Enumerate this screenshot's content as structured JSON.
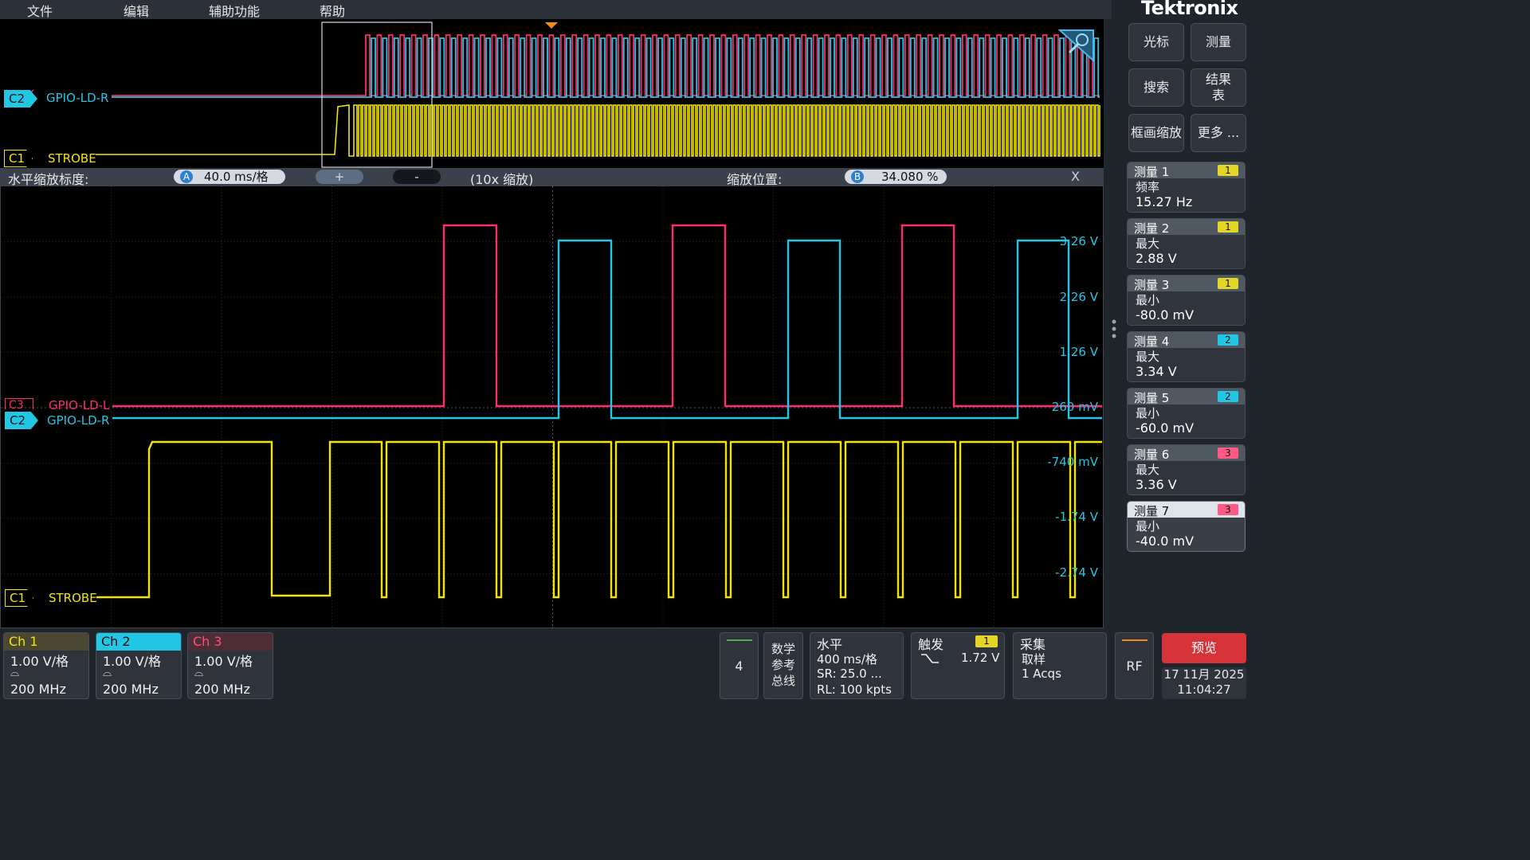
{
  "menu": {
    "file": "文件",
    "edit": "编辑",
    "utility": "辅助功能",
    "help": "帮助"
  },
  "brand": "Tektronix",
  "side_buttons": {
    "cursor": "光标",
    "measure": "测量",
    "search": "搜索",
    "results_line1": "结果",
    "results_line2": "表",
    "zoom": "框画缩放",
    "more": "更多 ..."
  },
  "measurements": [
    {
      "title": "测量 1",
      "badge": "1",
      "param": "频率",
      "value": "15.27 Hz"
    },
    {
      "title": "测量 2",
      "badge": "1",
      "param": "最大",
      "value": "2.88 V"
    },
    {
      "title": "测量 3",
      "badge": "1",
      "param": "最小",
      "value": "-80.0 mV"
    },
    {
      "title": "测量 4",
      "badge": "2",
      "param": "最大",
      "value": "3.34 V"
    },
    {
      "title": "测量 5",
      "badge": "2",
      "param": "最小",
      "value": "-60.0 mV"
    },
    {
      "title": "测量 6",
      "badge": "3",
      "param": "最大",
      "value": "3.36 V"
    },
    {
      "title": "测量 7",
      "badge": "3",
      "param": "最小",
      "value": "-40.0 mV"
    }
  ],
  "zoom_bar": {
    "label": "水平缩放标度:",
    "a_badge": "A",
    "scale": "40.0 ms/格",
    "plus": "+",
    "minus": "-",
    "factor": "(10x 缩放)",
    "pos_label": "缩放位置:",
    "b_badge": "B",
    "position": "34.080 %",
    "close": "X"
  },
  "channels": {
    "c1": {
      "badge": "C1",
      "label": "STROBE"
    },
    "c2": {
      "badge": "C2",
      "label": "GPIO-LD-R"
    },
    "c3": {
      "badge": "C3",
      "label": "GPIO-LD-L"
    }
  },
  "overview_c3_label": "GPIO-LD-R",
  "axis_labels": [
    "3.26 V",
    "2.26 V",
    "1.26 V",
    "260 mV",
    "-740 mV",
    "-1.74 V",
    "-2.74 V"
  ],
  "bottom": {
    "ch1": {
      "title": "Ch 1",
      "scale": "1.00 V/格",
      "bw": "200 MHz"
    },
    "ch2": {
      "title": "Ch 2",
      "scale": "1.00 V/格",
      "bw": "200 MHz"
    },
    "ch3": {
      "title": "Ch 3",
      "scale": "1.00 V/格",
      "bw": "200 MHz"
    },
    "more_ch": "4",
    "math_line1": "数学",
    "math_line2": "参考",
    "math_line3": "总线",
    "horizontal": {
      "title": "水平",
      "scale": "400 ms/格",
      "sr": "SR: 25.0 ...",
      "rl": "RL: 100 kpts"
    },
    "trigger": {
      "title": "触发",
      "badge": "1",
      "level": "1.72 V"
    },
    "acquire": {
      "title": "采集",
      "mode": "取样",
      "count": "1 Acqs"
    },
    "rf": "RF",
    "preview": "预览",
    "date": "17 11月 2025",
    "time": "11:04:27"
  },
  "colors": {
    "ch1": "#f4e500",
    "ch2": "#22c7e6",
    "ch3": "#ff2d6a",
    "preview": "#d7343a",
    "trigger_marker": "#f08a1e"
  }
}
